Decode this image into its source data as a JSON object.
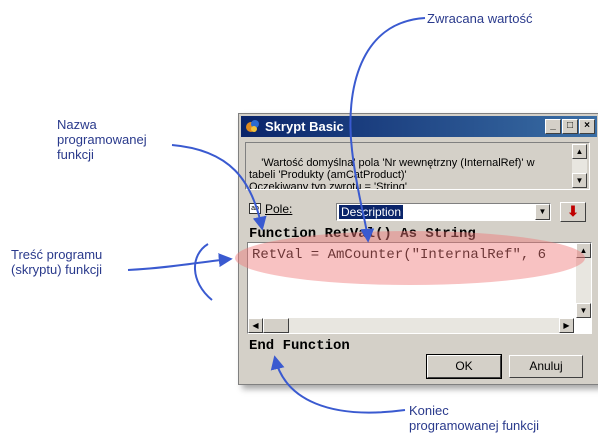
{
  "annotations": {
    "return_value": "Zwracana wartość",
    "function_name": "Nazwa\nprogramowanej\nfunkcji",
    "function_body": "Treść programu\n(skryptu) funkcji",
    "function_end": "Koniec\nprogramowanej funkcji"
  },
  "dialog": {
    "title": "Skrypt Basic",
    "title_buttons": [
      "_",
      "□",
      "×"
    ],
    "info_text": "'Wartość domyślna' pola 'Nr wewnętrzny (InternalRef)' w\ntabeli 'Produkty (amCatProduct)'\nOczekiwany typ zwrotu = 'String'",
    "field_label": "Pole:",
    "field_value": "Description",
    "code_header": "Function RetVal() As String",
    "code_line": "RetVal = AmCounter(\"InternalRef\", 6",
    "code_footer": "End Function",
    "ok_label": "OK",
    "cancel_label": "Anuluj"
  },
  "colors": {
    "title_bar": "#0a246a",
    "annotation_text": "#2a3a8c",
    "arrow": "#3a5ad0",
    "highlight": "#f07878",
    "insert_arrow": "#c00000"
  },
  "icons": {
    "title": "script-icon",
    "field": "field-icon",
    "insert": "insert-arrow-icon"
  }
}
